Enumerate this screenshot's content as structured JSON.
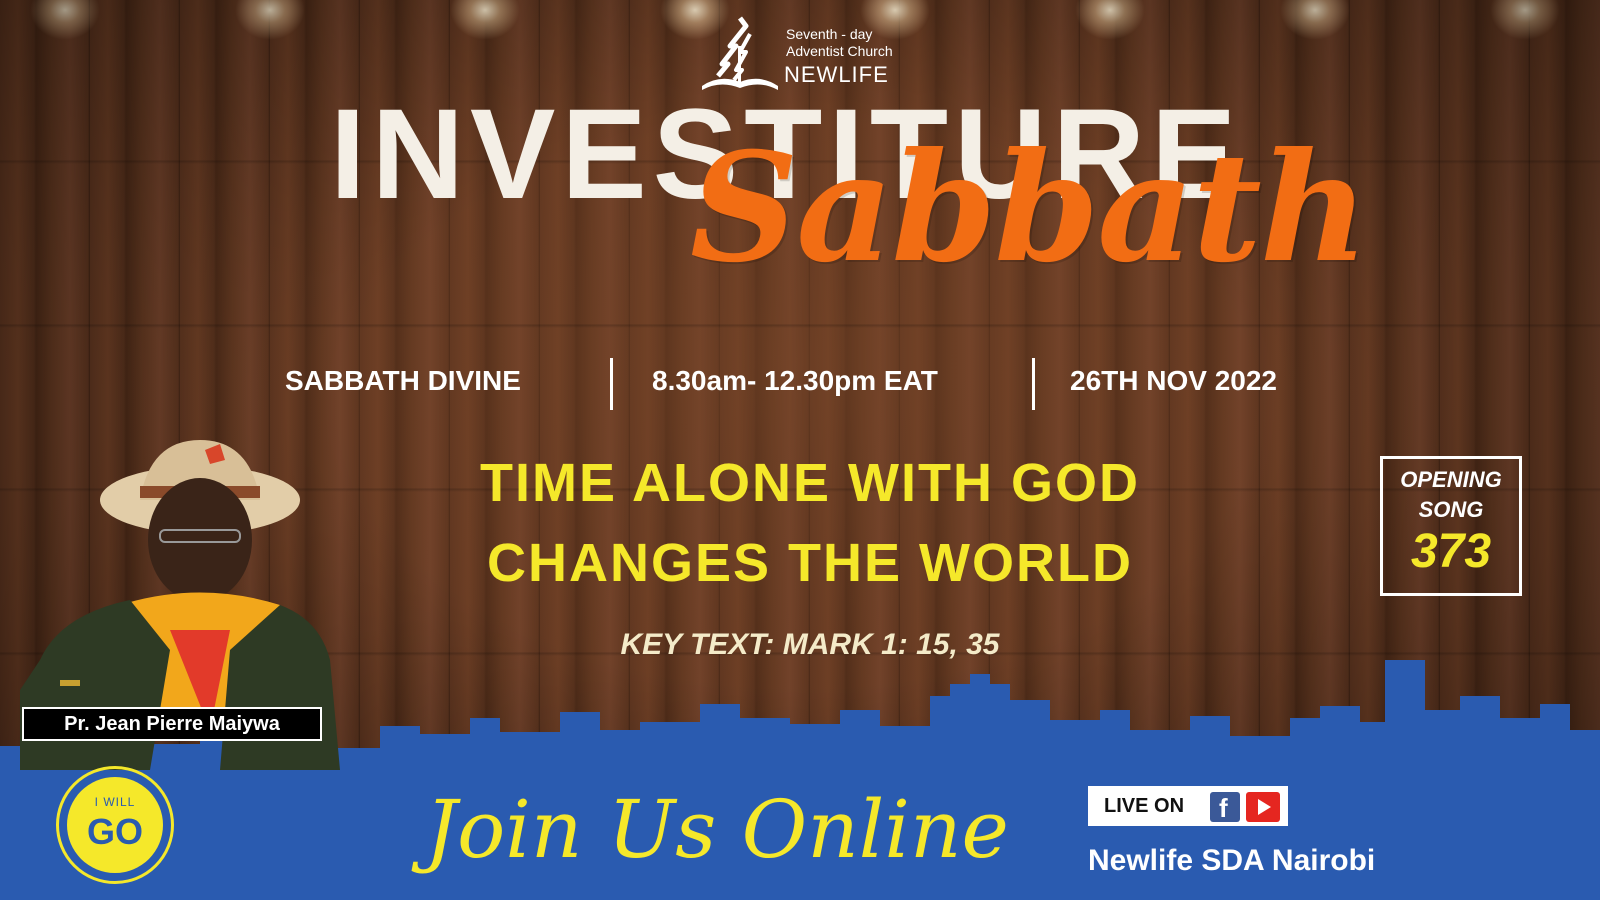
{
  "logo": {
    "line1": "Seventh - day",
    "line2": "Adventist Church",
    "line3": "NEWLIFE",
    "icon": "sda-church-logo-icon"
  },
  "title": {
    "main": "INVESTITURE",
    "script": "Sabbath"
  },
  "info": {
    "service": "SABBATH DIVINE",
    "time": "8.30am- 12.30pm EAT",
    "date": "26TH NOV 2022"
  },
  "theme": {
    "line1": "TIME ALONE WITH GOD",
    "line2": "CHANGES THE WORLD"
  },
  "key_text": "KEY TEXT: MARK 1: 15, 35",
  "opening_song": {
    "line1": "OPENING",
    "line2": "SONG",
    "number": "373"
  },
  "speaker": {
    "name": "Pr. Jean Pierre Maiywa"
  },
  "badge": {
    "line1": "I WILL",
    "line2": "GO"
  },
  "join": "Join Us Online",
  "live": {
    "label": "LIVE ON",
    "icons": [
      "facebook-icon",
      "youtube-icon"
    ]
  },
  "channel": "Newlife SDA Nairobi",
  "colors": {
    "accent_orange": "#f26d14",
    "accent_yellow": "#f5e82a",
    "band_blue": "#2a5bb0",
    "wood": "#5a331e"
  }
}
